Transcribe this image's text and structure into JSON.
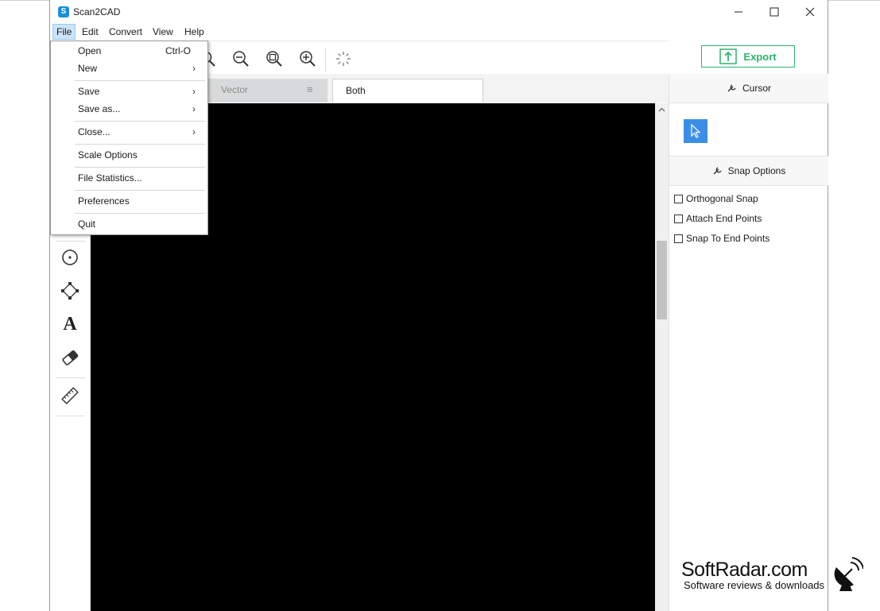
{
  "app": {
    "title": "Scan2CAD"
  },
  "window_controls": {
    "minimize": "—",
    "maximize": "☐",
    "close": "✕"
  },
  "menubar": [
    {
      "label": "File",
      "active": true
    },
    {
      "label": "Edit"
    },
    {
      "label": "Convert"
    },
    {
      "label": "View"
    },
    {
      "label": "Help"
    }
  ],
  "toolbar": {
    "icons": [
      "zoom-tool-icon",
      "zoom-out-icon",
      "zoom-fit-icon",
      "zoom-in-icon",
      "loading-spinner-icon"
    ],
    "export_label": "Export"
  },
  "tabs": [
    {
      "label": "Vector",
      "menu_icon": "≡",
      "active": false
    },
    {
      "label": "Both",
      "active": true
    }
  ],
  "left_tools": [
    "circle-tool-icon",
    "select-nodes-icon",
    "text-tool-icon",
    "eraser-icon",
    "ruler-icon"
  ],
  "right_panel": {
    "cursor_header": "Cursor",
    "snap_header": "Snap Options",
    "snap_options": [
      {
        "label": "Orthogonal Snap",
        "checked": false
      },
      {
        "label": "Attach End Points",
        "checked": false
      },
      {
        "label": "Snap To End Points",
        "checked": false
      }
    ]
  },
  "file_menu": {
    "items": [
      {
        "label": "Open",
        "shortcut": "Ctrl-O"
      },
      {
        "label": "New",
        "submenu": true
      },
      {
        "label": "Save",
        "submenu": true
      },
      {
        "label": "Save as...",
        "submenu": true
      },
      {
        "label": "Close...",
        "submenu": true
      },
      {
        "label": "Scale Options"
      },
      {
        "label": "File Statistics..."
      },
      {
        "label": "Preferences"
      },
      {
        "label": "Quit"
      }
    ],
    "submenu_arrow": "›"
  },
  "watermark": {
    "title": "SoftRadar.com",
    "subtitle": "Software reviews & downloads"
  },
  "colors": {
    "export_green": "#2fb36f",
    "cursor_blue": "#3b8ee8",
    "menu_highlight": "#cce4f7"
  }
}
